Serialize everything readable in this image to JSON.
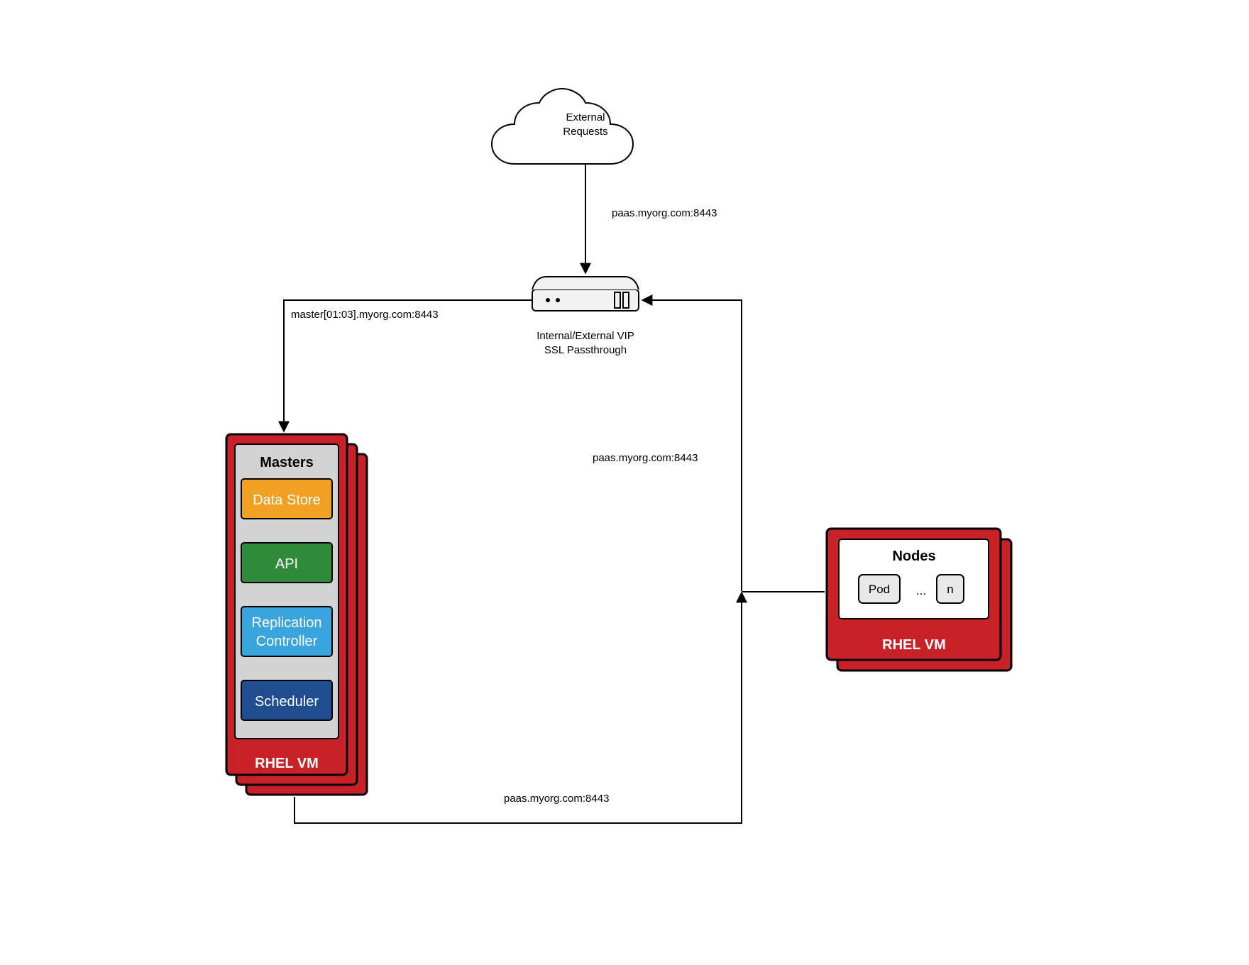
{
  "cloud": {
    "line1": "External",
    "line2": "Requests"
  },
  "vip": {
    "line1": "Internal/External VIP",
    "line2": "SSL Passthrough"
  },
  "edges": {
    "cloud_to_vip": "paas.myorg.com:8443",
    "vip_to_masters": "master[01:03].myorg.com:8443",
    "nodes_to_vip": "paas.myorg.com:8443",
    "masters_to_vip": "paas.myorg.com:8443"
  },
  "masters": {
    "title": "Masters",
    "components": {
      "datastore": "Data Store",
      "api": "API",
      "replication1": "Replication",
      "replication2": "Controller",
      "scheduler": "Scheduler"
    },
    "footer": "RHEL VM"
  },
  "nodes": {
    "title": "Nodes",
    "pod": "Pod",
    "ellipsis": "...",
    "n": "n",
    "footer": "RHEL VM"
  },
  "colors": {
    "red": "#c82127",
    "orange": "#f2a024",
    "green": "#2f8a3a",
    "blue": "#3aa5dc",
    "navy": "#1f4d8f",
    "grey": "#d3d3d3",
    "ltgrey": "#e8e8e8"
  }
}
